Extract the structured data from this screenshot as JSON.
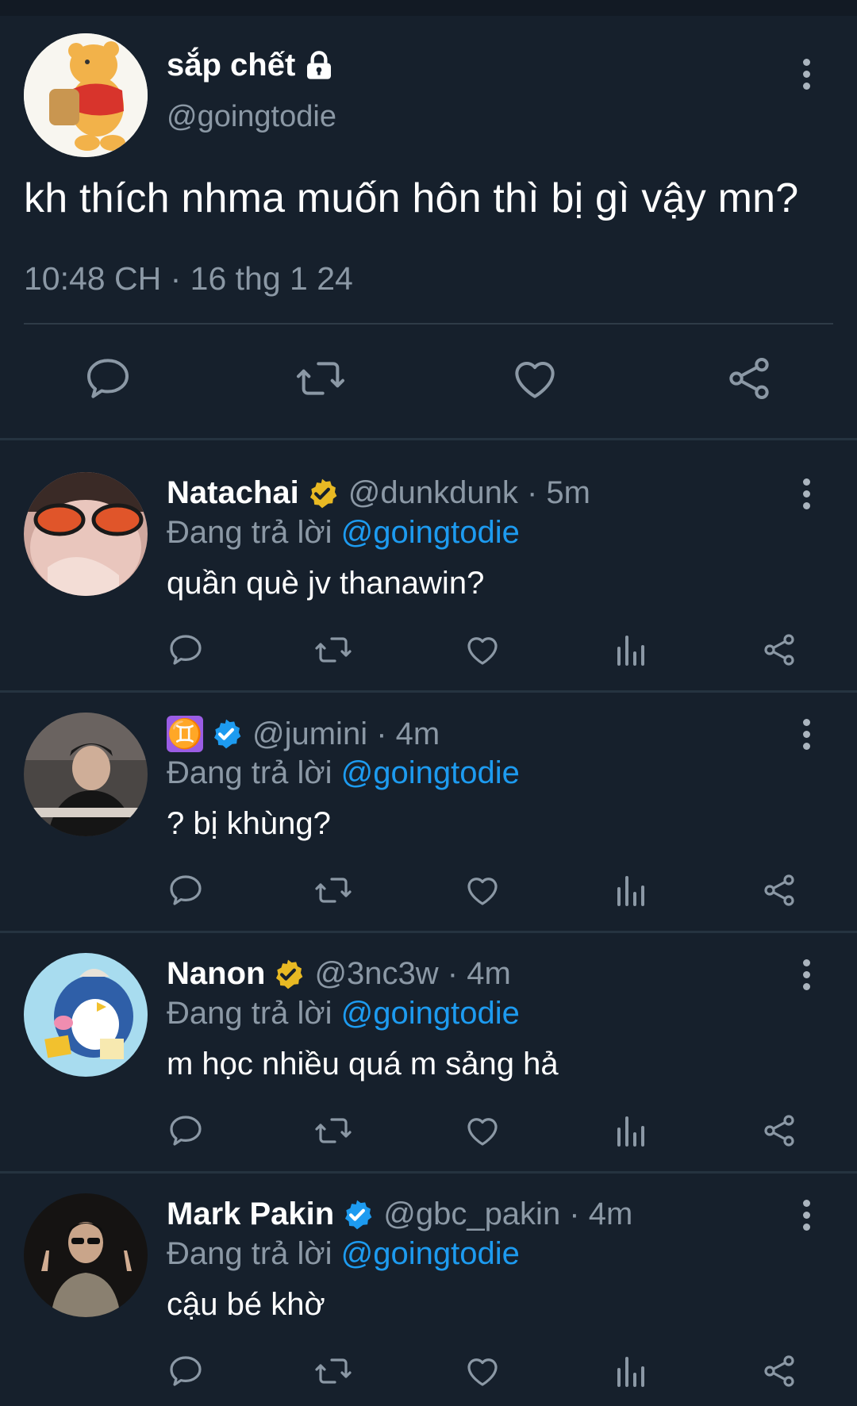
{
  "tweet": {
    "display_name": "sắp chết",
    "handle": "@goingtodie",
    "text": "kh thích nhma muốn hôn thì bị gì vậy mn?",
    "meta": "10:48 CH · 16 thg 1 24"
  },
  "replies": [
    {
      "name": "Natachai",
      "badge": "gold-verified",
      "handle_time": "@dunkdunk · 5m",
      "replying_prefix": "Đang trả lời",
      "mention": "@goingtodie",
      "text": "quần què jv thanawin?"
    },
    {
      "name": "♊",
      "badge": "blue-verified",
      "handle_time": "@jumini · 4m",
      "replying_prefix": "Đang trả lời",
      "mention": "@goingtodie",
      "text": "? bị khùng?"
    },
    {
      "name": "Nanon",
      "badge": "gold-verified",
      "handle_time": "@3nc3w · 4m",
      "replying_prefix": "Đang trả lời",
      "mention": "@goingtodie",
      "text": "m học nhiều quá m sảng hả"
    },
    {
      "name": "Mark Pakin",
      "badge": "blue-verified",
      "handle_time": "@gbc_pakin · 4m",
      "replying_prefix": "Đang trả lời",
      "mention": "@goingtodie",
      "text": "cậu bé khờ"
    }
  ],
  "colors": {
    "background": "#16202c",
    "muted_text": "#8b98a5",
    "link": "#1d9bf0",
    "gold_badge": "#e8b923",
    "blue_badge": "#1d9bf0"
  }
}
